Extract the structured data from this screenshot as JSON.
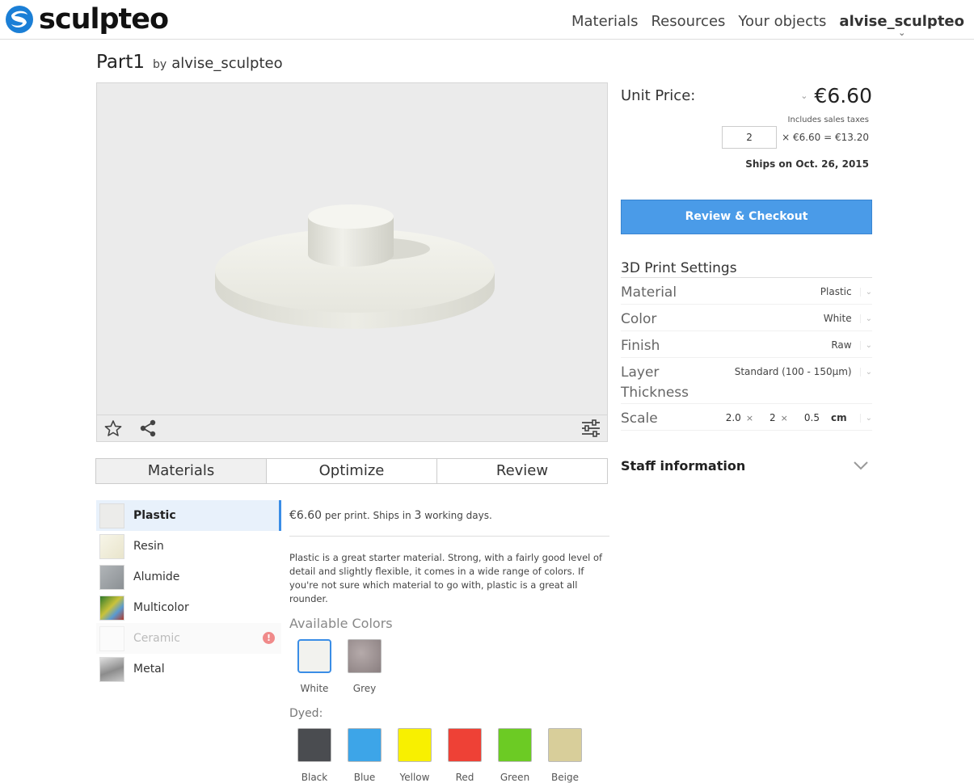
{
  "header": {
    "brand": "sculpteo",
    "nav": [
      "Materials",
      "Resources",
      "Your objects"
    ],
    "user": "alvise_sculpteo"
  },
  "object": {
    "title": "Part1",
    "by": "by",
    "author": "alvise_sculpteo"
  },
  "tabs": [
    "Materials",
    "Optimize",
    "Review"
  ],
  "materials": [
    {
      "name": "Plastic",
      "color": "#ececea",
      "active": true
    },
    {
      "name": "Resin",
      "color": "#f3f0e0"
    },
    {
      "name": "Alumide",
      "color": "#9ea3a6"
    },
    {
      "name": "Multicolor",
      "color": "#6a9b3a"
    },
    {
      "name": "Ceramic",
      "color": "#f7f7f7",
      "disabled": true
    },
    {
      "name": "Metal",
      "color": "#b4b4b4"
    }
  ],
  "material_detail": {
    "price": "€6.60",
    "price_suffix": "per print. Ships in",
    "days": "3",
    "days_suffix": "working days.",
    "description": "Plastic is a great starter material. Strong, with a fairly good level of detail and slightly flexible, it comes in a wide range of colors. If you're not sure which material to go with, plastic is a great all rounder.",
    "available_colors_label": "Available Colors",
    "colors": [
      {
        "name": "White",
        "hex": "#f2f2ee",
        "selected": true
      },
      {
        "name": "Grey",
        "hex": "#9a8f8f"
      }
    ],
    "dyed_label": "Dyed:",
    "dyed": [
      {
        "name": "Black",
        "hex": "#4a4c50"
      },
      {
        "name": "Blue",
        "hex": "#3da5e8"
      },
      {
        "name": "Yellow",
        "hex": "#f8f000"
      },
      {
        "name": "Red",
        "hex": "#ee4136"
      },
      {
        "name": "Green",
        "hex": "#6ccb24"
      },
      {
        "name": "Beige",
        "hex": "#d8ce9a"
      }
    ]
  },
  "pricing": {
    "unit_price_label": "Unit Price:",
    "unit_price": "€6.60",
    "includes_taxes": "Includes sales taxes",
    "quantity": "2",
    "calc": "× €6.60 = €13.20",
    "ships": "Ships on Oct. 26, 2015",
    "checkout_label": "Review & Checkout"
  },
  "settings": {
    "title": "3D Print Settings",
    "rows": [
      {
        "label": "Material",
        "value": "Plastic"
      },
      {
        "label": "Color",
        "value": "White"
      },
      {
        "label": "Finish",
        "value": "Raw"
      },
      {
        "label": "Layer Thickness",
        "value": "Standard (100 - 150µm)"
      }
    ],
    "scale": {
      "label": "Scale",
      "x": "2.0",
      "y": "2",
      "z": "0.5",
      "unit": "cm",
      "times": "×"
    }
  },
  "staff": {
    "title": "Staff information"
  },
  "colors": {
    "accent": "#3a8de6",
    "checkout": "#4a9be8",
    "logo": "#1b7fd6"
  }
}
